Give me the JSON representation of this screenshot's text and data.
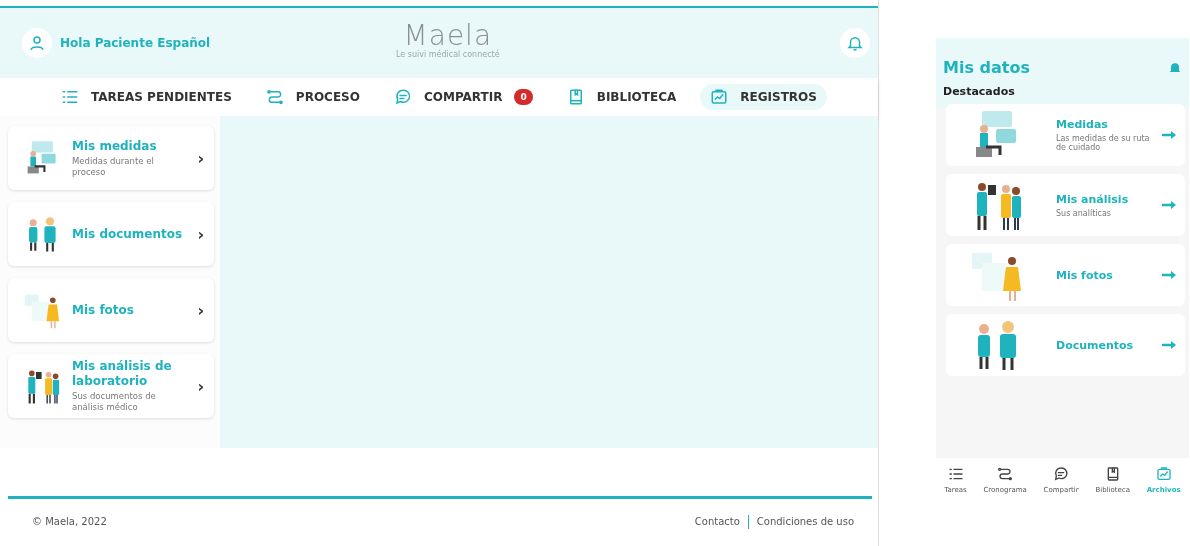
{
  "web": {
    "greeting": "Hola Paciente Español",
    "logo": {
      "name": "Maela",
      "tagline": "Le suivi médical connecté"
    },
    "nav": [
      {
        "label": "TAREAS PENDIENTES",
        "selected": false
      },
      {
        "label": "PROCESO",
        "selected": false
      },
      {
        "label": "COMPARTIR",
        "selected": false,
        "badge": "0"
      },
      {
        "label": "BIBLIOTECA",
        "selected": false
      },
      {
        "label": "REGISTROS",
        "selected": true
      }
    ],
    "cards": [
      {
        "title": "Mis medidas",
        "subtitle": "Medidas durante el proceso",
        "chevron": "›"
      },
      {
        "title": "Mis documentos",
        "chevron": "›"
      },
      {
        "title": "Mis fotos",
        "chevron": "›"
      },
      {
        "title": "Mis análisis de laboratorio",
        "subtitle": "Sus documentos de análisis médico",
        "chevron": "›"
      }
    ],
    "footer": {
      "copyright": "© Maela, 2022",
      "links": [
        "Contacto",
        "Condiciones de uso"
      ]
    }
  },
  "phone": {
    "title": "Mis datos",
    "section": "Destacados",
    "cards": [
      {
        "title": "Medidas",
        "subtitle": "Las medidas de su ruta de cuidado"
      },
      {
        "title": "Mis análisis",
        "subtitle": "Sus analíticas"
      },
      {
        "title": "Mis fotos"
      },
      {
        "title": "Documentos"
      }
    ],
    "tabs": [
      {
        "label": "Tareas",
        "selected": false
      },
      {
        "label": "Cronograma",
        "selected": false
      },
      {
        "label": "Compartir",
        "selected": false
      },
      {
        "label": "Biblioteca",
        "selected": false
      },
      {
        "label": "Archivos",
        "selected": true
      }
    ]
  }
}
